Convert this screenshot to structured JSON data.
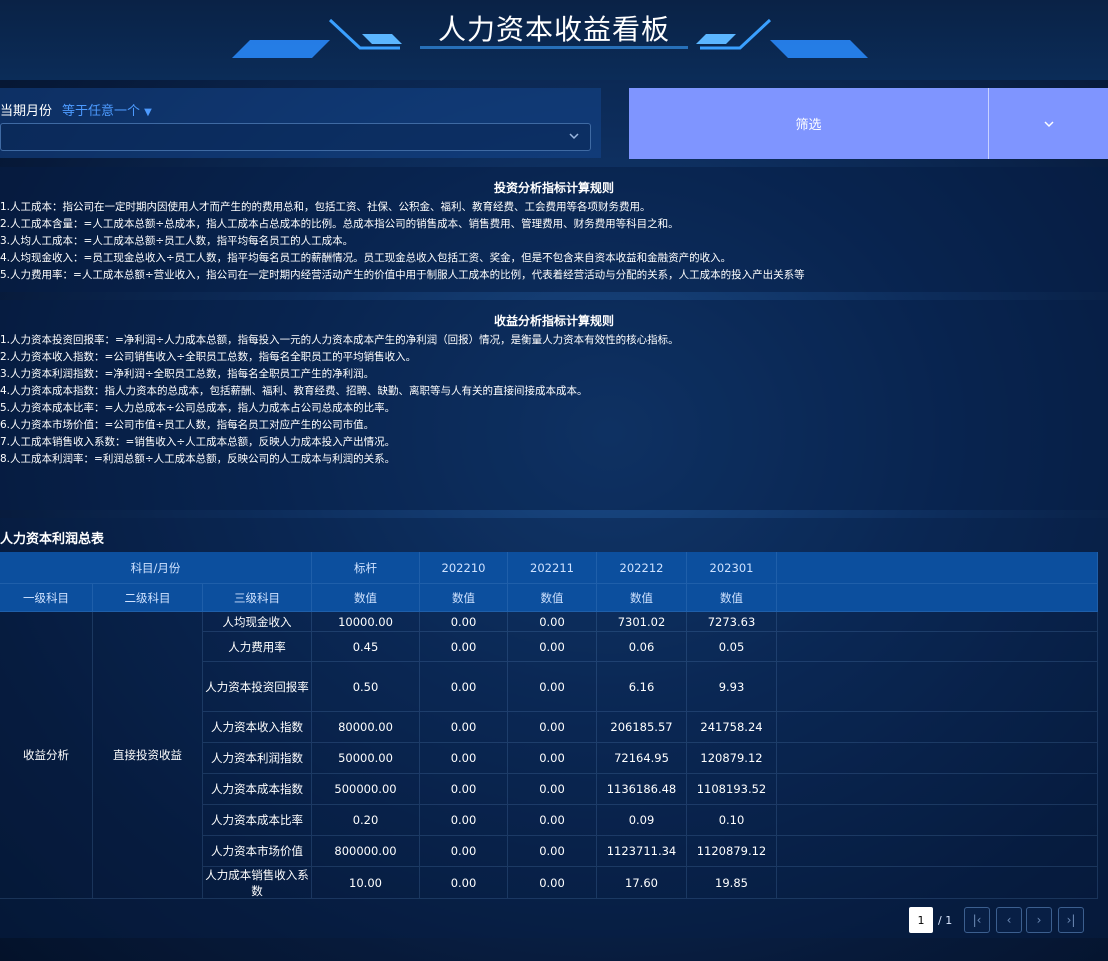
{
  "header": {
    "title": "人力资本收益看板"
  },
  "filter": {
    "label": "当期月份",
    "operator": "等于任意一个",
    "value": "",
    "button_label": "筛选"
  },
  "invest_rules": {
    "title": "投资分析指标计算规则",
    "lines": [
      "1.人工成本：指公司在一定时期内因使用人才而产生的的费用总和，包括工资、社保、公积金、福利、教育经费、工会费用等各项财务费用。",
      "2.人工成本含量：=人工成本总额÷总成本，指人工成本占总成本的比例。总成本指公司的销售成本、销售费用、管理费用、财务费用等科目之和。",
      "3.人均人工成本：=人工成本总额÷员工人数，指平均每名员工的人工成本。",
      "4.人均现金收入：=员工现金总收入÷员工人数，指平均每名员工的薪酬情况。员工现金总收入包括工资、奖金，但是不包含来自资本收益和金融资产的收入。",
      "5.人力费用率：=人工成本总额÷营业收入，指公司在一定时期内经营活动产生的价值中用于制服人工成本的比例，代表着经营活动与分配的关系，人工成本的投入产出关系等"
    ]
  },
  "revenue_rules": {
    "title": "收益分析指标计算规则",
    "lines": [
      "1.人力资本投资回报率：=净利润÷人力成本总额，指每投入一元的人力资本成本产生的净利润（回报）情况，是衡量人力资本有效性的核心指标。",
      "2.人力资本收入指数：=公司销售收入÷全职员工总数，指每名全职员工的平均销售收入。",
      "3.人力资本利润指数：=净利润÷全职员工总数，指每名全职员工产生的净利润。",
      "4.人力资本成本指数：指人力资本的总成本，包括薪酬、福利、教育经费、招聘、缺勤、离职等与人有关的直接间接成本成本。",
      "5.人力资本成本比率：=人力总成本÷公司总成本，指人力成本占公司总成本的比率。",
      "6.人力资本市场价值：=公司市值÷员工人数，指每名员工对应产生的公司市值。",
      "7.人工成本销售收入系数：=销售收入÷人工成本总额，反映人力成本投入产出情况。",
      "8.人工成本利润率：=利润总额÷人工成本总额，反映公司的人工成本与利润的关系。"
    ]
  },
  "table": {
    "title": "人力资本利润总表",
    "header1": {
      "subject_month": "科目/月份",
      "cols": [
        "标杆",
        "202210",
        "202211",
        "202212",
        "202301"
      ]
    },
    "header2": {
      "level1": "一级科目",
      "level2": "二级科目",
      "level3": "三级科目",
      "value": "数值"
    },
    "group": {
      "level1": "收益分析",
      "level2": "直接投资收益"
    },
    "rows": [
      {
        "name": "人均现金收入",
        "values": [
          "10000.00",
          "0.00",
          "0.00",
          "7301.02",
          "7273.63"
        ]
      },
      {
        "name": "人力费用率",
        "values": [
          "0.45",
          "0.00",
          "0.00",
          "0.06",
          "0.05"
        ]
      },
      {
        "name": "人力资本投资回报率",
        "values": [
          "0.50",
          "0.00",
          "0.00",
          "6.16",
          "9.93"
        ]
      },
      {
        "name": "人力资本收入指数",
        "values": [
          "80000.00",
          "0.00",
          "0.00",
          "206185.57",
          "241758.24"
        ]
      },
      {
        "name": "人力资本利润指数",
        "values": [
          "50000.00",
          "0.00",
          "0.00",
          "72164.95",
          "120879.12"
        ]
      },
      {
        "name": "人力资本成本指数",
        "values": [
          "500000.00",
          "0.00",
          "0.00",
          "1136186.48",
          "1108193.52"
        ]
      },
      {
        "name": "人力资本成本比率",
        "values": [
          "0.20",
          "0.00",
          "0.00",
          "0.09",
          "0.10"
        ]
      },
      {
        "name": "人力资本市场价值",
        "values": [
          "800000.00",
          "0.00",
          "0.00",
          "1123711.34",
          "1120879.12"
        ]
      },
      {
        "name": "人力成本销售收入系数",
        "values": [
          "10.00",
          "0.00",
          "0.00",
          "17.60",
          "19.85"
        ]
      }
    ]
  },
  "pager": {
    "current": "1",
    "total": "/ 1"
  },
  "icons": [
    "chevron-down-icon",
    "first-page-icon",
    "prev-page-icon",
    "next-page-icon",
    "last-page-icon"
  ]
}
